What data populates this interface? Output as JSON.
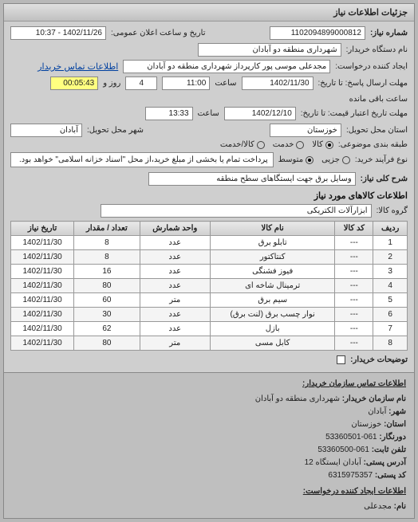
{
  "panel_title": "جزئیات اطلاعات نیاز",
  "fields": {
    "need_no_label": "شماره نیاز:",
    "need_no": "1102094899000812",
    "announce_label": "تاریخ و ساعت اعلان عمومی:",
    "announce_value": "1402/11/26 - 10:37",
    "buyer_org_label": "نام دستگاه خریدار:",
    "buyer_org": "شهرداری منطقه دو آبادان",
    "creator_label": "ایجاد کننده درخواست:",
    "creator": "مجدعلی موسی پور کارپرداز شهرداری منطقه دو آبادان",
    "contact_link": "اطلاعات تماس خریدار",
    "deadline_label": "مهلت ارسال پاسخ: تا تاریخ:",
    "deadline_date": "1402/11/30",
    "deadline_time_label": "ساعت",
    "deadline_time": "11:00",
    "remain_days": "4",
    "remain_days_label": "روز و",
    "remain_time": "00:05:43",
    "remain_label": "ساعت باقی مانده",
    "validity_label": "مهلت تاریخ اعتبار قیمت: تا تاریخ:",
    "validity_date": "1402/12/10",
    "validity_time": "13:33",
    "province_label": "استان محل تحویل:",
    "province": "خوزستان",
    "city_label": "شهر محل تحویل:",
    "city": "آبادان",
    "class_label": "طبقه بندی موضوعی:",
    "class_options": {
      "goods": "کالا",
      "service": "خدمت",
      "both": "کالا/خدمت"
    },
    "priority_label": "نوع فرآیند خرید:",
    "priority_options": {
      "minor": "جزیی",
      "medium": "متوسط"
    },
    "note": "پرداخت تمام یا بخشی از مبلغ خرید،از محل \"اسناد خزانه اسلامی\" خواهد بود.",
    "subject_label": "شرح کلی نیاز:",
    "subject": "وسایل برق جهت ایستگاهای سطح منطقه",
    "goods_section_title": "اطلاعات کالاهای مورد نیاز",
    "goods_group_label": "گروه کالا:",
    "goods_group": "ابزارآلات الکتریکی",
    "buyer_notes_label": "توضیحات خریدار:"
  },
  "table": {
    "headers": {
      "row": "ردیف",
      "code": "کد کالا",
      "name": "نام کالا",
      "unit": "واحد شمارش",
      "qty": "تعداد / مقدار",
      "date": "تاریخ نیاز"
    },
    "rows": [
      {
        "n": 1,
        "code": "---",
        "name": "تابلو برق",
        "unit": "عدد",
        "qty": 8,
        "date": "1402/11/30"
      },
      {
        "n": 2,
        "code": "---",
        "name": "کنتاکتور",
        "unit": "عدد",
        "qty": 8,
        "date": "1402/11/30"
      },
      {
        "n": 3,
        "code": "---",
        "name": "فیوز فشنگی",
        "unit": "عدد",
        "qty": 16,
        "date": "1402/11/30"
      },
      {
        "n": 4,
        "code": "---",
        "name": "ترمینال شاخه ای",
        "unit": "عدد",
        "qty": 80,
        "date": "1402/11/30"
      },
      {
        "n": 5,
        "code": "---",
        "name": "سیم برق",
        "unit": "متر",
        "qty": 60,
        "date": "1402/11/30"
      },
      {
        "n": 6,
        "code": "---",
        "name": "نوار چسب برق (لنت برق)",
        "unit": "عدد",
        "qty": 30,
        "date": "1402/11/30"
      },
      {
        "n": 7,
        "code": "---",
        "name": "بازل",
        "unit": "عدد",
        "qty": 62,
        "date": "1402/11/30"
      },
      {
        "n": 8,
        "code": "---",
        "name": "کابل مسی",
        "unit": "متر",
        "qty": 80,
        "date": "1402/11/30"
      }
    ]
  },
  "contact": {
    "title": "اطلاعات تماس سازمان خریدار:",
    "org_name_label": "نام سازمان خریدار:",
    "org_name": "شهرداری منطقه دو آبادان",
    "city_label": "شهر:",
    "city": "آبادان",
    "province_label": "استان:",
    "province": "خوزستان",
    "fax_label": "دورنگار:",
    "fax": "061-53360501",
    "tel_label": "تلفن ثابت:",
    "tel": "061-53360500",
    "address_label": "آدرس پستی:",
    "address": "آبادان ایستگاه 12",
    "postal_label": "کد پستی:",
    "postal": "6315975357",
    "creator_title": "اطلاعات ایجاد کننده درخواست:",
    "creator_name_label": "نام:",
    "creator_name": "مجدعلی"
  }
}
